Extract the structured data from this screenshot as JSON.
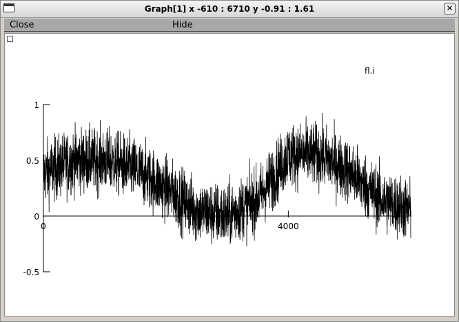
{
  "window": {
    "title": "Graph[1]  x -610 : 6710  y -0.91 : 1.61"
  },
  "menu": {
    "close_label": "Close",
    "hide_label": "Hide"
  },
  "chart_data": {
    "type": "line",
    "legend_label": "fl.i",
    "x_range": [
      0,
      6000
    ],
    "y_range": [
      -0.5,
      1
    ],
    "x_ticks": [
      {
        "value": 0,
        "label": "0"
      },
      {
        "value": 4000,
        "label": "4000"
      }
    ],
    "y_ticks": [
      {
        "value": 1,
        "label": "1"
      },
      {
        "value": 0.5,
        "label": "0.5"
      },
      {
        "value": 0,
        "label": "0"
      },
      {
        "value": -0.5,
        "label": "-0.5"
      }
    ],
    "series": [
      {
        "signal_center": [
          [
            0,
            0.38
          ],
          [
            500,
            0.5
          ],
          [
            1000,
            0.5
          ],
          [
            1500,
            0.42
          ],
          [
            2000,
            0.25
          ],
          [
            2500,
            0.05
          ],
          [
            3000,
            0.0
          ],
          [
            3500,
            0.15
          ],
          [
            4000,
            0.55
          ],
          [
            4500,
            0.55
          ],
          [
            5000,
            0.4
          ],
          [
            5500,
            0.15
          ],
          [
            6000,
            0.05
          ]
        ],
        "noise_amplitude": 0.3,
        "color": "#000000"
      }
    ]
  }
}
